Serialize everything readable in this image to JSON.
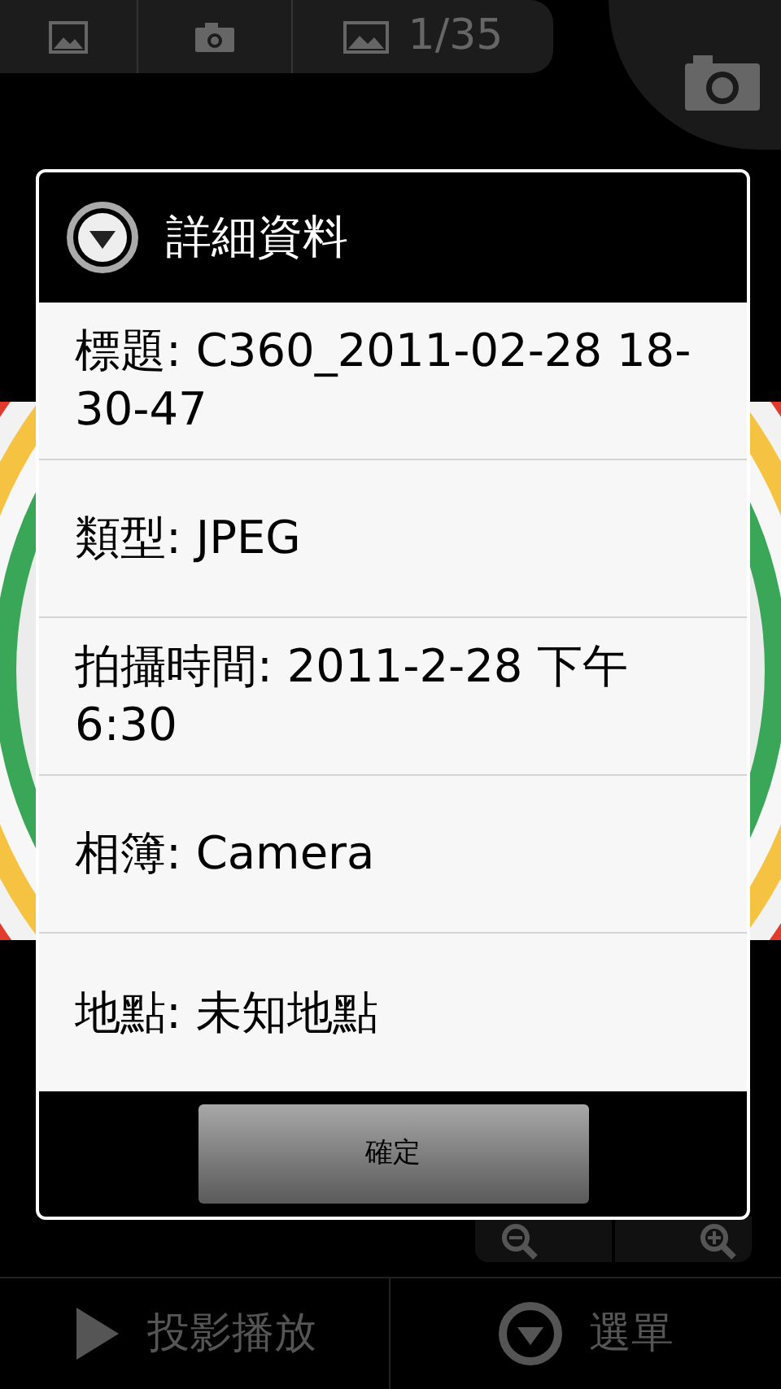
{
  "breadcrumb": {
    "counter": "1/35"
  },
  "dialog": {
    "title": "詳細資料",
    "details": [
      "標題: C360_2011-02-28 18-30-47",
      "類型: JPEG",
      "拍攝時間: 2011-2-28 下午 6:30",
      "相簿: Camera",
      "地點: 未知地點"
    ],
    "button": "確定"
  },
  "bottom_bar": {
    "slideshow": "投影播放",
    "menu": "選單"
  }
}
